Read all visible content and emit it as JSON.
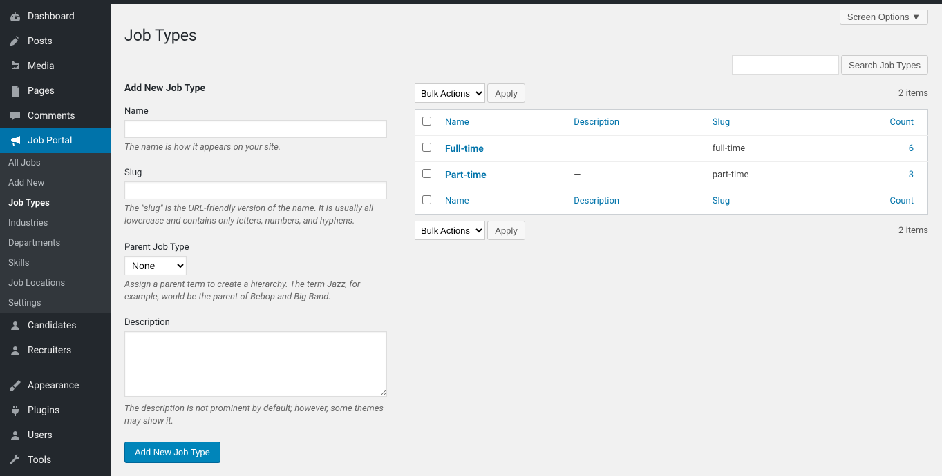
{
  "screen_options_label": "Screen Options ▼",
  "page_title": "Job Types",
  "sidebar": [
    {
      "label": "Dashboard",
      "icon": "dashboard"
    },
    {
      "label": "Posts",
      "icon": "pin"
    },
    {
      "label": "Media",
      "icon": "media"
    },
    {
      "label": "Pages",
      "icon": "page"
    },
    {
      "label": "Comments",
      "icon": "comment"
    },
    {
      "label": "Job Portal",
      "icon": "megaphone",
      "active": true,
      "submenu": [
        "All Jobs",
        "Add New",
        "Job Types",
        "Industries",
        "Departments",
        "Skills",
        "Job Locations",
        "Settings"
      ],
      "current": "Job Types"
    },
    {
      "label": "Candidates",
      "icon": "user"
    },
    {
      "label": "Recruiters",
      "icon": "user"
    },
    {
      "sep": true
    },
    {
      "label": "Appearance",
      "icon": "brush"
    },
    {
      "label": "Plugins",
      "icon": "plug"
    },
    {
      "label": "Users",
      "icon": "user"
    },
    {
      "label": "Tools",
      "icon": "wrench"
    }
  ],
  "search": {
    "button": "Search Job Types"
  },
  "form": {
    "heading": "Add New Job Type",
    "name": {
      "label": "Name",
      "help": "The name is how it appears on your site."
    },
    "slug": {
      "label": "Slug",
      "help": "The \"slug\" is the URL-friendly version of the name. It is usually all lowercase and contains only letters, numbers, and hyphens."
    },
    "parent": {
      "label": "Parent Job Type",
      "selected": "None",
      "help": "Assign a parent term to create a hierarchy. The term Jazz, for example, would be the parent of Bebop and Big Band."
    },
    "description": {
      "label": "Description",
      "help": "The description is not prominent by default; however, some themes may show it."
    },
    "submit": "Add New Job Type"
  },
  "table": {
    "bulk_label": "Bulk Actions",
    "apply_label": "Apply",
    "items_count": "2 items",
    "cols": {
      "name": "Name",
      "description": "Description",
      "slug": "Slug",
      "count": "Count"
    },
    "rows": [
      {
        "name": "Full-time",
        "description": "—",
        "slug": "full-time",
        "count": "6"
      },
      {
        "name": "Part-time",
        "description": "—",
        "slug": "part-time",
        "count": "3"
      }
    ]
  }
}
